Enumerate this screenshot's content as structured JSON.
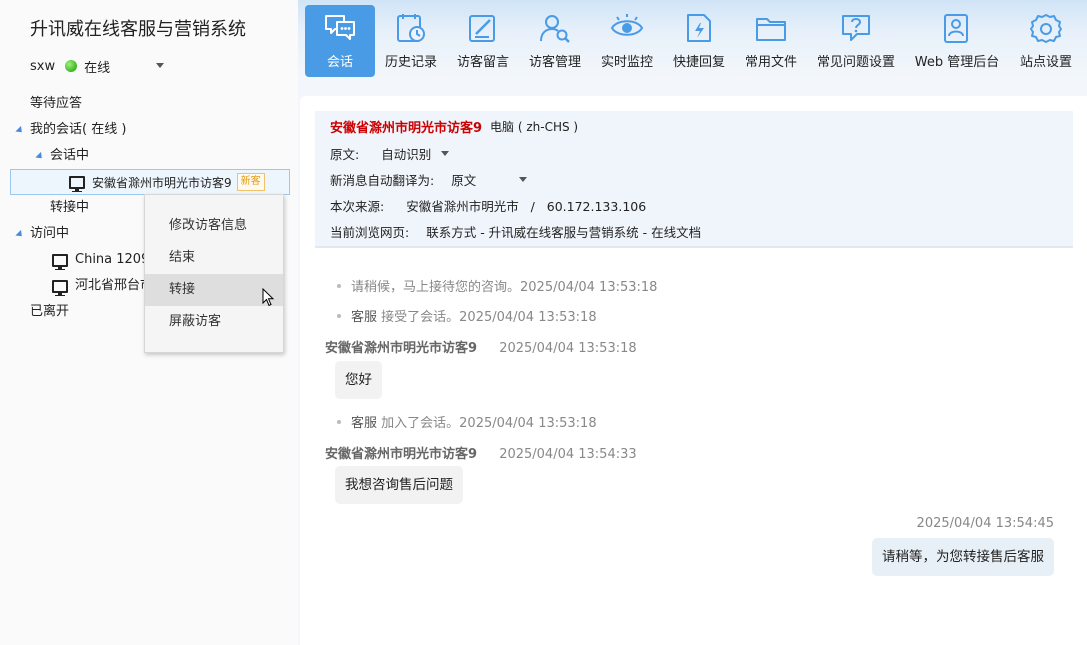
{
  "app": {
    "title": "升讯威在线客服与营销系统"
  },
  "user": {
    "name": "sxw",
    "status": "在线"
  },
  "tree": {
    "waiting": "等待应答",
    "my_sessions": "我的会话( 在线 )",
    "in_session": "会话中",
    "active_visitor": "安徽省滁州市明光市访客9",
    "active_badge": "新客",
    "transferring": "转接中",
    "visiting": "访问中",
    "visitors": [
      "China 1209",
      "河北省邢台市"
    ],
    "left": "已离开"
  },
  "context_menu": {
    "items": [
      "修改访客信息",
      "结束",
      "转接",
      "屏蔽访客"
    ],
    "highlighted": "转接"
  },
  "toolbar": {
    "items": [
      {
        "label": "会话",
        "icon": "chat-icon"
      },
      {
        "label": "历史记录",
        "icon": "history-icon"
      },
      {
        "label": "访客留言",
        "icon": "message-edit-icon"
      },
      {
        "label": "访客管理",
        "icon": "visitor-search-icon"
      },
      {
        "label": "实时监控",
        "icon": "eye-icon"
      },
      {
        "label": "快捷回复",
        "icon": "quick-reply-icon"
      },
      {
        "label": "常用文件",
        "icon": "folder-icon"
      },
      {
        "label": "常见问题设置",
        "icon": "faq-icon"
      },
      {
        "label": "Web 管理后台",
        "icon": "admin-user-icon"
      },
      {
        "label": "站点设置",
        "icon": "settings-icon"
      }
    ],
    "active": "会话"
  },
  "visitor_info": {
    "name": "安徽省滁州市明光市访客9",
    "device": "电脑 ( zh-CHS )",
    "source_lang_label": "原文:",
    "source_lang_value": "自动识别",
    "translate_label": "新消息自动翻译为:",
    "translate_value": "原文",
    "source_label": "本次来源:",
    "source_value": "安徽省滁州市明光市   /   60.172.133.106",
    "page_label": "当前浏览网页:",
    "page_value": "联系方式 - 升讯威在线客服与营销系统 - 在线文档"
  },
  "messages": {
    "sys1": "请稍候，马上接待您的咨询。2025/04/04 13:53:18",
    "sys2_agent": "客服",
    "sys2_text": " 接受了会话。2025/04/04 13:53:18",
    "head1_name": "安徽省滁州市明光市访客9",
    "head1_time": "2025/04/04 13:53:18",
    "bubble1": "您好",
    "sys3_agent": "客服",
    "sys3_text": " 加入了会话。2025/04/04 13:53:18",
    "head2_name": "安徽省滁州市明光市访客9",
    "head2_time": "2025/04/04 13:54:33",
    "bubble2": "我想咨询售后问题",
    "my_time": "2025/04/04 13:54:45",
    "my_bubble": "请稍等，为您转接售后客服"
  },
  "colors": {
    "accent": "#4a9be6",
    "visitor_name": "#cc0000",
    "online": "#3cb521",
    "badge": "#e39b11"
  }
}
